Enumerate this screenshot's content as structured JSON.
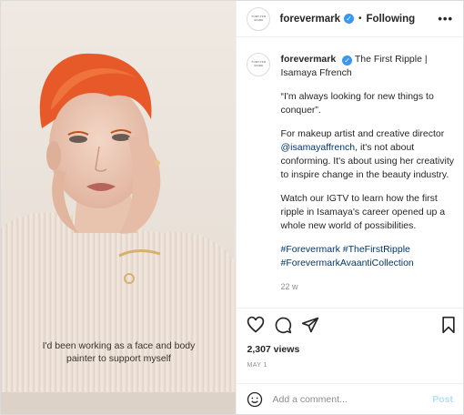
{
  "header": {
    "username": "forevermark",
    "separator": "•",
    "follow_status": "Following",
    "more": "•••",
    "avatar_logo_text": "FOREVERMARK"
  },
  "media": {
    "overlay_caption_line1": "I'd been working as a face and body",
    "overlay_caption_line2": "painter to support myself"
  },
  "caption": {
    "username": "forevermark",
    "title": "The First Ripple | Isamaya Ffrench",
    "quote": "“I'm always looking for new things to conquer”.",
    "para2_prefix": "For makeup artist and creative director ",
    "mention": "@isamayaffrench",
    "para2_suffix": ", it's not about conforming. It's about using her creativity to inspire change in the beauty industry.",
    "para3": "Watch our IGTV to learn how the first ripple in Isamaya's career opened up a whole new world of possibilities.",
    "hashtags_line1": "#Forevermark #TheFirstRipple",
    "hashtags_line2": "#ForevermarkAvaantiCollection",
    "age": "22 w"
  },
  "stats": {
    "views": "2,307 views",
    "date": "MAY 1"
  },
  "comment": {
    "placeholder": "Add a comment...",
    "post_label": "Post"
  },
  "icons": [
    "heart-icon",
    "comment-icon",
    "share-icon",
    "bookmark-icon",
    "emoji-icon",
    "verified-icon"
  ],
  "colors": {
    "verified": "#3897f0",
    "link": "#00376b",
    "post_disabled": "#b2dffc",
    "hair": "#e8592a"
  }
}
